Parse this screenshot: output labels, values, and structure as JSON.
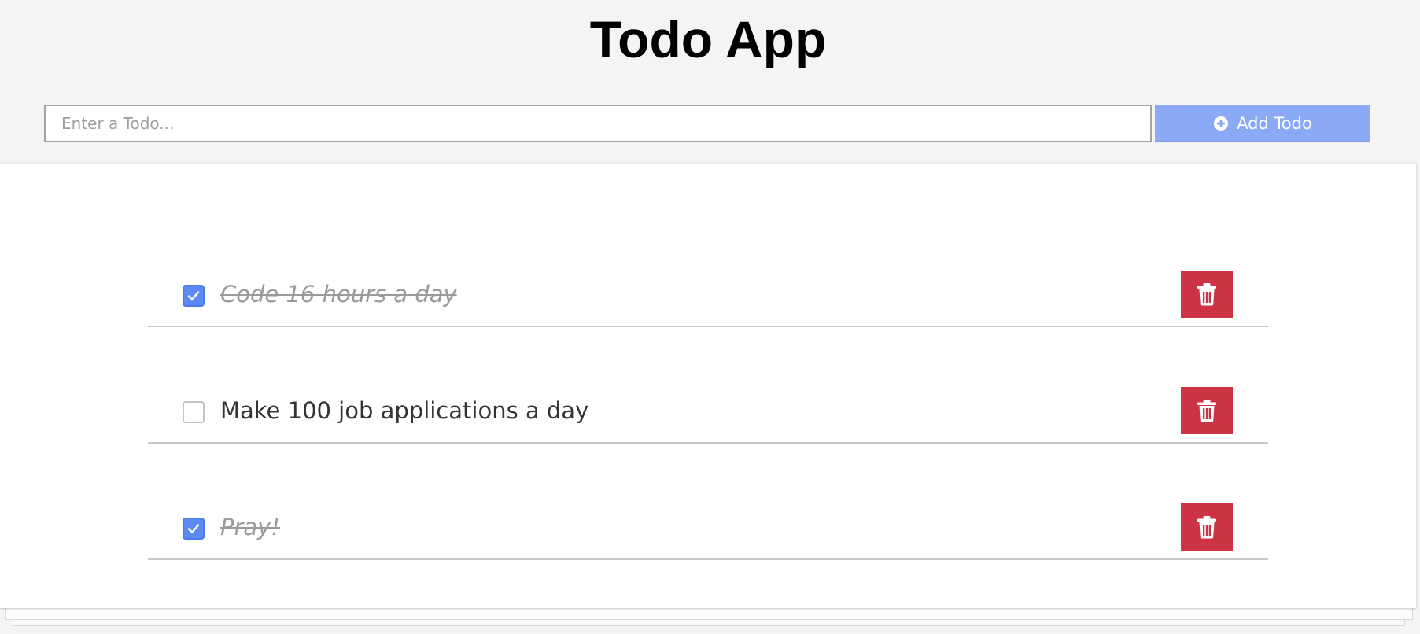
{
  "app": {
    "title": "Todo App"
  },
  "form": {
    "input_placeholder": "Enter a Todo...",
    "input_value": "",
    "add_button_label": "Add Todo",
    "add_button_icon": "plus-circle-icon"
  },
  "todos": [
    {
      "text": "Code 16 hours a day",
      "completed": true,
      "delete_icon": "trash-icon"
    },
    {
      "text": "Make 100 job applications a day",
      "completed": false,
      "delete_icon": "trash-icon"
    },
    {
      "text": "Pray!",
      "completed": true,
      "delete_icon": "trash-icon"
    }
  ],
  "colors": {
    "page_background": "#f4f4f4",
    "add_button": "#8ca9f5",
    "checkbox_checked": "#5b8af5",
    "delete_button": "#cc3446",
    "completed_text": "#9a9a9a",
    "active_text": "#333333"
  }
}
